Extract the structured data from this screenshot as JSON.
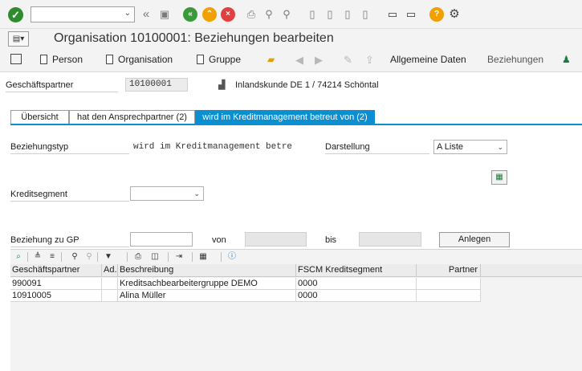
{
  "toolbar": {
    "command_field_value": "",
    "icons": [
      "enter-icon",
      "back-icon",
      "save-icon",
      "exit-icon",
      "cancel-icon",
      "print-icon",
      "find-icon",
      "find-next-icon",
      "first-page-icon",
      "prev-page-icon",
      "next-page-icon",
      "last-page-icon",
      "new-session-icon",
      "shortcut-icon",
      "help-icon",
      "settings-icon"
    ]
  },
  "header": {
    "title": "Organisation 10100001: Beziehungen bearbeiten"
  },
  "app_toolbar": {
    "person": "Person",
    "organisation": "Organisation",
    "gruppe": "Gruppe",
    "allgemeine_daten": "Allgemeine Daten",
    "beziehungen": "Beziehungen"
  },
  "partner": {
    "label": "Geschäftspartner",
    "value": "10100001",
    "description": "Inlandskunde DE 1 / 74214 Schöntal"
  },
  "tabs": [
    {
      "label": "Übersicht"
    },
    {
      "label": "hat den Ansprechpartner (2)"
    },
    {
      "label": "wird im Kreditmanagement betreut von (2)"
    }
  ],
  "form": {
    "beziehungstyp_label": "Beziehungstyp",
    "beziehungstyp_value": "wird im Kreditmanagement betre",
    "darstellung_label": "Darstellung",
    "darstellung_value": "A Liste",
    "kreditsegment_label": "Kreditsegment",
    "kreditsegment_value": "",
    "beziehung_label": "Beziehung zu GP",
    "von_label": "von",
    "bis_label": "bis",
    "anlegen_label": "Anlegen"
  },
  "grid": {
    "columns": [
      "Geschäftspartner",
      "Ad..",
      "Beschreibung",
      "FSCM Kreditsegment",
      "Partner"
    ],
    "rows": [
      [
        "990091",
        "",
        "Kreditsachbearbeitergruppe DEMO",
        "0000",
        ""
      ],
      [
        "10910005",
        "",
        "Alina Müller",
        "0000",
        ""
      ]
    ]
  },
  "colors": {
    "accent": "#0b8fd1",
    "ok_green": "#2e8b2e",
    "help_orange": "#f0a000"
  }
}
